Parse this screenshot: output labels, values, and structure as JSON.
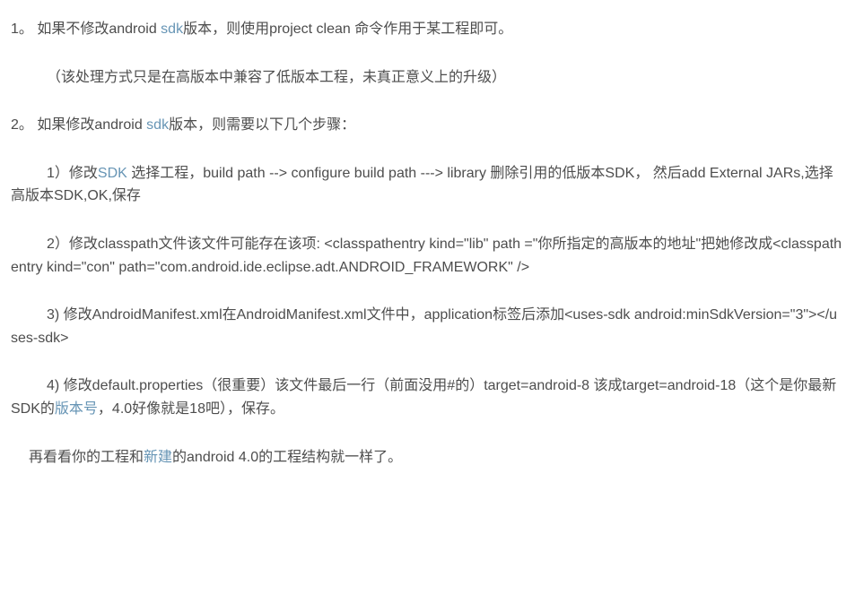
{
  "para1": {
    "t1": "1。 如果不修改android ",
    "link": "sdk",
    "t2": "版本，则使用project clean 命令作用于某工程即可。"
  },
  "para2": "（该处理方式只是在高版本中兼容了低版本工程，未真正意义上的升级）",
  "para3": {
    "t1": "2。 如果修改android ",
    "link": "sdk",
    "t2": "版本，则需要以下几个步骤："
  },
  "para4": {
    "t1": "1）修改",
    "link": "SDK",
    "t2": " 选择工程，build path --> configure build path ---> library 删除引用的低版本SDK， 然后add External JARs,选择高版本SDK,OK,保存"
  },
  "para5": "2）修改classpath文件该文件可能存在该项: <classpathentry kind=\"lib\"   path =\"你所指定的高版本的地址\"把她修改成<classpathentry kind=\"con\" path=\"com.android.ide.eclipse.adt.ANDROID_FRAMEWORK\" />",
  "para6": "3) 修改AndroidManifest.xml在AndroidManifest.xml文件中，application标签后添加<uses-sdk android:minSdkVersion=\"3\"></uses-sdk>",
  "para7": {
    "t1": "4) 修改default.properties（很重要）该文件最后一行（前面没用#的）target=android-8 该成target=android-18（这个是你最新SDK的",
    "link": "版本号",
    "t2": "，4.0好像就是18吧），保存。"
  },
  "para8": {
    "t1": "再看看你的工程和",
    "link": "新建",
    "t2": "的android 4.0的工程结构就一样了。"
  }
}
